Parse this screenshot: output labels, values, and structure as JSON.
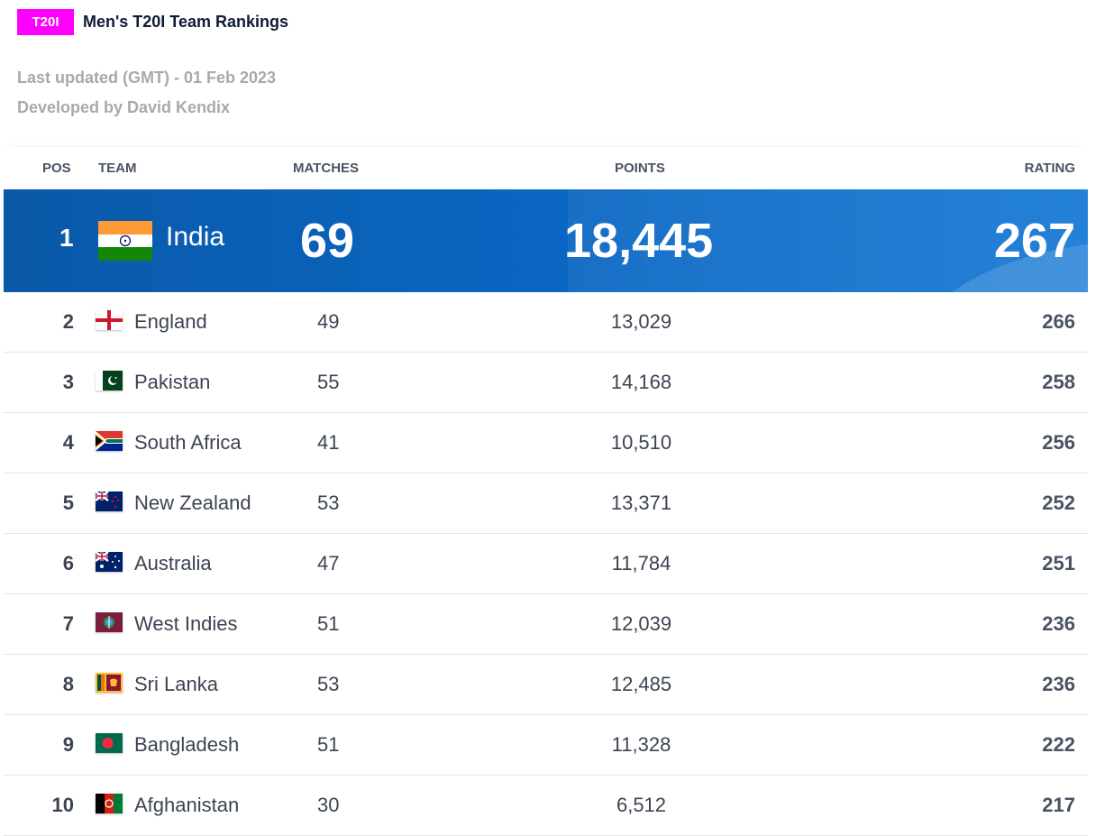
{
  "header": {
    "badge": "T20I",
    "title": "Men's T20I Team Rankings",
    "last_updated": "Last updated (GMT) - 01 Feb 2023",
    "developer": "Developed by David Kendix"
  },
  "table": {
    "columns": {
      "pos": "POS",
      "team": "TEAM",
      "matches": "MATCHES",
      "points": "POINTS",
      "rating": "RATING"
    },
    "leader": {
      "pos": "1",
      "team": "India",
      "matches": "69",
      "points": "18,445",
      "rating": "267",
      "flag": "india-flag-icon"
    },
    "rows": [
      {
        "pos": "2",
        "team": "England",
        "matches": "49",
        "points": "13,029",
        "rating": "266",
        "flag": "england-flag-icon"
      },
      {
        "pos": "3",
        "team": "Pakistan",
        "matches": "55",
        "points": "14,168",
        "rating": "258",
        "flag": "pakistan-flag-icon"
      },
      {
        "pos": "4",
        "team": "South Africa",
        "matches": "41",
        "points": "10,510",
        "rating": "256",
        "flag": "south-africa-flag-icon"
      },
      {
        "pos": "5",
        "team": "New Zealand",
        "matches": "53",
        "points": "13,371",
        "rating": "252",
        "flag": "new-zealand-flag-icon"
      },
      {
        "pos": "6",
        "team": "Australia",
        "matches": "47",
        "points": "11,784",
        "rating": "251",
        "flag": "australia-flag-icon"
      },
      {
        "pos": "7",
        "team": "West Indies",
        "matches": "51",
        "points": "12,039",
        "rating": "236",
        "flag": "west-indies-flag-icon"
      },
      {
        "pos": "8",
        "team": "Sri Lanka",
        "matches": "53",
        "points": "12,485",
        "rating": "236",
        "flag": "sri-lanka-flag-icon"
      },
      {
        "pos": "9",
        "team": "Bangladesh",
        "matches": "51",
        "points": "11,328",
        "rating": "222",
        "flag": "bangladesh-flag-icon"
      },
      {
        "pos": "10",
        "team": "Afghanistan",
        "matches": "30",
        "points": "6,512",
        "rating": "217",
        "flag": "afghanistan-flag-icon"
      }
    ]
  },
  "colors": {
    "badge": "#ff00ff",
    "leader_bg": "#0a66c2",
    "title": "#0d1b36",
    "muted": "#a9a9a9"
  }
}
